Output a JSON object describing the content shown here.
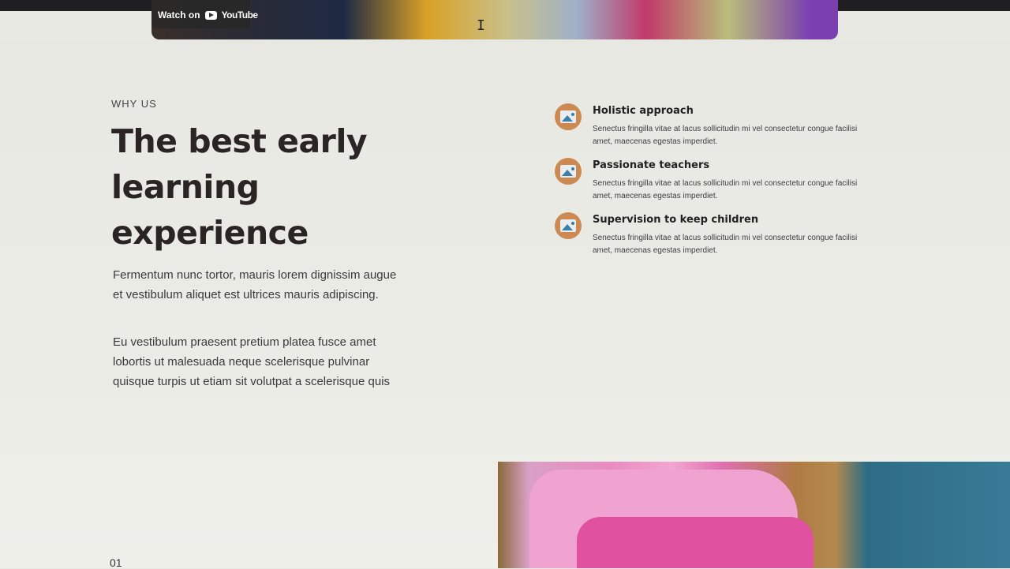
{
  "video": {
    "watch_on_label": "Watch on",
    "platform_label": "YouTube"
  },
  "section": {
    "eyebrow": "WHY US",
    "heading": "The best early learning experience",
    "paragraph_1": "Fermentum nunc tortor, mauris lorem dignissim augue et vestibulum aliquet est ultrices mauris adipiscing.",
    "paragraph_2": "Eu vestibulum praesent pretium platea fusce amet lobortis ut malesuada neque scelerisque pulvinar quisque turpis ut etiam sit volutpat a scelerisque quis"
  },
  "features": [
    {
      "title": "Holistic approach",
      "description": "Senectus fringilla vitae at lacus sollicitudin mi vel consectetur congue facilisi amet, maecenas egestas imperdiet.",
      "icon": "image-icon"
    },
    {
      "title": "Passionate teachers",
      "description": "Senectus fringilla vitae at lacus sollicitudin mi vel consectetur congue facilisi amet, maecenas egestas imperdiet.",
      "icon": "image-icon"
    },
    {
      "title": "Supervision to keep children",
      "description": "Senectus fringilla vitae at lacus sollicitudin mi vel consectetur congue facilisi amet, maecenas egestas imperdiet.",
      "icon": "image-icon"
    }
  ],
  "pager": {
    "current": "01"
  },
  "colors": {
    "accent": "#cc8a52",
    "heading": "#2b2424",
    "background": "#e9e9e3"
  }
}
